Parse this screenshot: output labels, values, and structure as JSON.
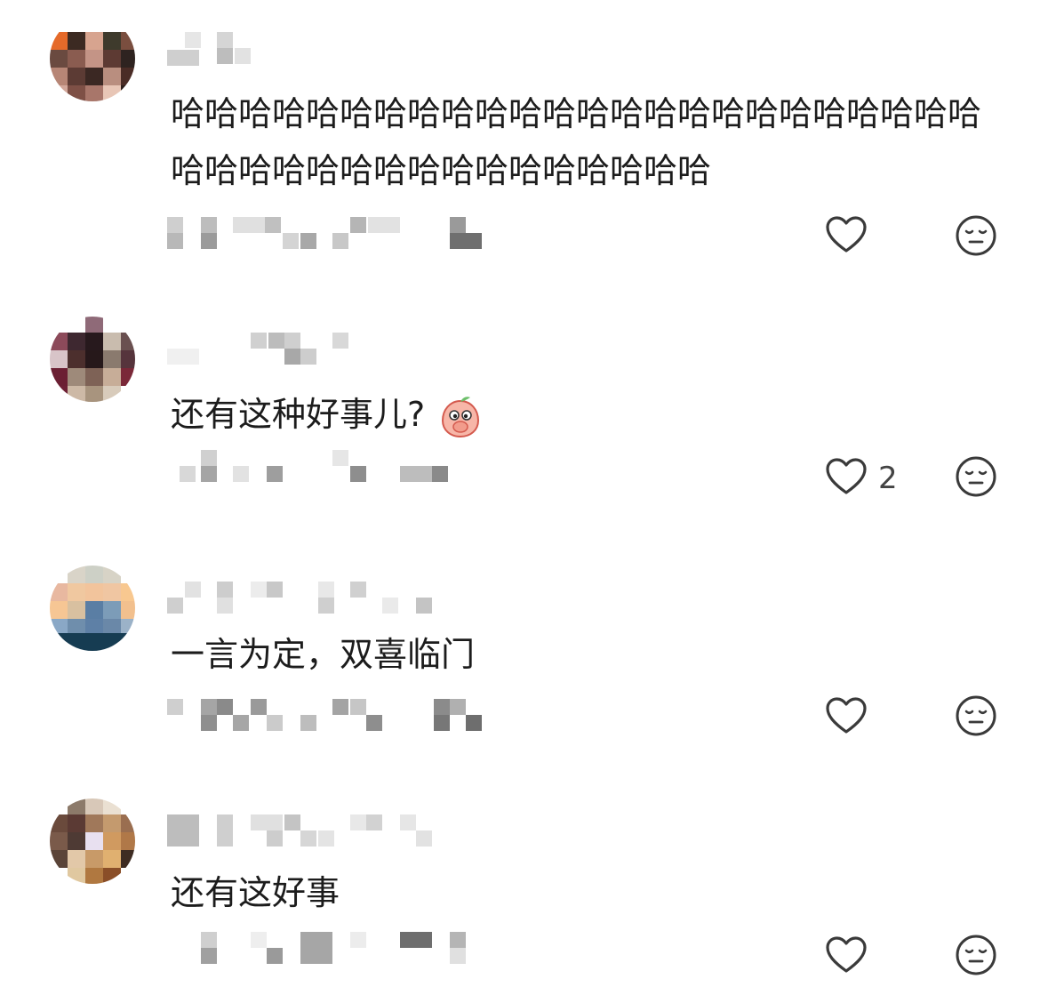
{
  "comments": [
    {
      "text": "哈哈哈哈哈哈哈哈哈哈哈哈哈哈哈哈哈哈哈哈哈哈哈哈哈哈哈哈哈哈哈哈哈哈哈哈哈哈哈哈",
      "like_count": ""
    },
    {
      "text": "还有这种好事儿?",
      "like_count": "2",
      "emoji": "peach-covering-mouth-emoji"
    },
    {
      "text": "一言为定，双喜临门",
      "like_count": ""
    },
    {
      "text": "还有这好事",
      "like_count": ""
    }
  ],
  "icons": {
    "like": "heart-outline-icon",
    "dislike": "expressionless-face-icon"
  },
  "colors": {
    "icon_stroke": "#3a3a3a",
    "text": "#1c1c1c",
    "blur_gray": "#9a9a9a"
  }
}
